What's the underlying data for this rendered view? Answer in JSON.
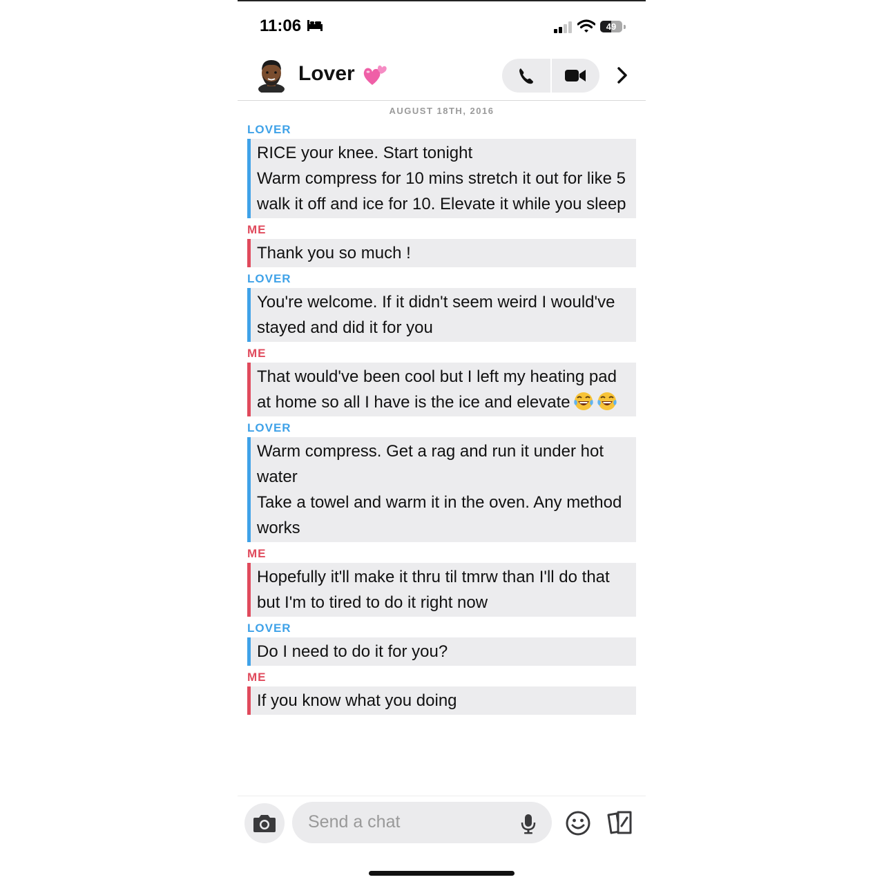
{
  "status_bar": {
    "time": "11:06",
    "battery_level": "49",
    "battery_fraction": 0.49
  },
  "header": {
    "contact_name": "Lover",
    "contact_emoji": "two-hearts",
    "icons": [
      "avatar",
      "phone-icon",
      "video-camera-icon",
      "chevron-right-icon"
    ]
  },
  "chat": {
    "date": "AUGUST 18TH, 2016",
    "messages": [
      {
        "sender": "LOVER",
        "text": "RICE your knee. Start tonight\nWarm compress for 10 mins stretch it out for like 5 walk it off and ice for 10. Elevate it while you sleep"
      },
      {
        "sender": "ME",
        "text": "Thank you so much !"
      },
      {
        "sender": "LOVER",
        "text": "You're welcome. If it didn't seem weird I would've stayed and did it for you"
      },
      {
        "sender": "ME",
        "text": "That would've been cool but I left my heating pad at home so all I have is the ice and elevate",
        "trailing_emoji": "face-with-tears-of-joy x2"
      },
      {
        "sender": "LOVER",
        "text": "Warm compress. Get a rag and run it under hot water\nTake a towel and warm it in the oven. Any method works"
      },
      {
        "sender": "ME",
        "text": "Hopefully it'll make it thru til tmrw than I'll do that but I'm to tired to do it right now"
      },
      {
        "sender": "LOVER",
        "text": "Do I need to do it for you?"
      },
      {
        "sender": "ME",
        "text": "If you know what you doing"
      }
    ]
  },
  "composer": {
    "placeholder": "Send a chat",
    "icons": [
      "camera-icon",
      "mic-icon",
      "emoji-icon",
      "cards-icon"
    ]
  },
  "colors": {
    "lover_accent": "#3fa2e8",
    "me_accent": "#e04a5c",
    "bubble_bg": "#ececee"
  }
}
